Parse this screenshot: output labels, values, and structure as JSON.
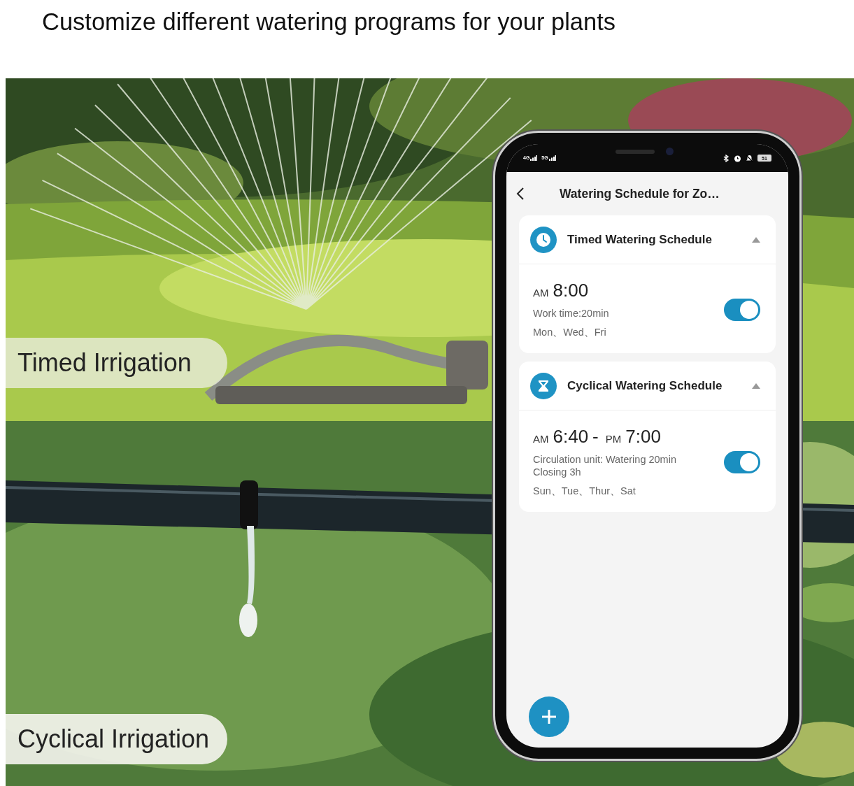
{
  "subtitle": "Customize different watering programs for your plants",
  "scene_labels": [
    "Timed Irrigation",
    "Cyclical Irrigation"
  ],
  "phone": {
    "status_bar": {
      "networks": [
        "4G",
        "5G"
      ],
      "battery": "51"
    },
    "title": "Watering Schedule for Zo…",
    "schedules": [
      {
        "kind": "timed",
        "title": "Timed Watering Schedule",
        "expanded": true,
        "time": [
          {
            "kind": "period",
            "text": "AM"
          },
          {
            "kind": "clock",
            "text": "8:00"
          }
        ],
        "details": [
          "Work time:20min"
        ],
        "days": "Mon、Wed、Fri",
        "on": true
      },
      {
        "kind": "cyclical",
        "title": "Cyclical Watering Schedule",
        "expanded": true,
        "time": [
          {
            "kind": "period",
            "text": "AM"
          },
          {
            "kind": "clock",
            "text": "6:40"
          },
          {
            "kind": "separator",
            "text": "-"
          },
          {
            "kind": "period",
            "text": "PM"
          },
          {
            "kind": "clock",
            "text": "7:00"
          }
        ],
        "details": [
          "Circulation unit: Watering 20min",
          "Closing 3h"
        ],
        "days": "Sun、Tue、Thur、Sat",
        "on": true
      }
    ]
  }
}
